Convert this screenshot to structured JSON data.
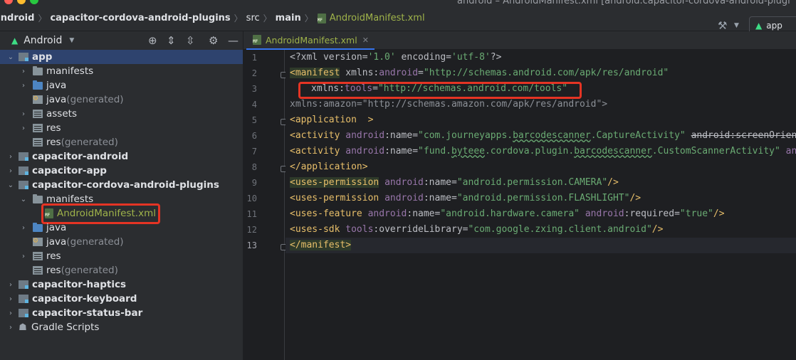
{
  "window": {
    "title": "android – AndroidManifest.xml [android.capacitor-cordova-android-plugi"
  },
  "breadcrumb": [
    "android",
    "capacitor-cordova-android-plugins",
    "src",
    "main",
    "AndroidManifest.xml"
  ],
  "toolbar": {
    "run_config": "app"
  },
  "project_panel": {
    "view_mode": "Android",
    "tree": [
      {
        "label": "app",
        "suffix": ""
      },
      {
        "label": "manifests",
        "suffix": ""
      },
      {
        "label": "java",
        "suffix": ""
      },
      {
        "label": "java",
        "suffix": " (generated)"
      },
      {
        "label": "assets",
        "suffix": ""
      },
      {
        "label": "res",
        "suffix": ""
      },
      {
        "label": "res",
        "suffix": " (generated)"
      },
      {
        "label": "capacitor-android",
        "suffix": ""
      },
      {
        "label": "capacitor-app",
        "suffix": ""
      },
      {
        "label": "capacitor-cordova-android-plugins",
        "suffix": ""
      },
      {
        "label": "manifests",
        "suffix": ""
      },
      {
        "label": "AndroidManifest.xml",
        "suffix": ""
      },
      {
        "label": "java",
        "suffix": ""
      },
      {
        "label": "java",
        "suffix": " (generated)"
      },
      {
        "label": "res",
        "suffix": ""
      },
      {
        "label": "res",
        "suffix": " (generated)"
      },
      {
        "label": "capacitor-haptics",
        "suffix": ""
      },
      {
        "label": "capacitor-keyboard",
        "suffix": ""
      },
      {
        "label": "capacitor-status-bar",
        "suffix": ""
      },
      {
        "label": "Gradle Scripts",
        "suffix": ""
      }
    ]
  },
  "editor": {
    "tab_label": "AndroidManifest.xml",
    "line_numbers": [
      "1",
      "2",
      "3",
      "4",
      "5",
      "6",
      "7",
      "8",
      "9",
      "10",
      "11",
      "12",
      "13"
    ],
    "lines": {
      "l1": {
        "a": "<?xml version=",
        "b": "'1.0'",
        "c": " encoding=",
        "d": "'utf-8'",
        "e": "?>"
      },
      "l2": {
        "tag": "<manifest",
        "a1": " xmlns:",
        "a1ns": "android",
        "a1eq": "=",
        "v1": "\"http://schemas.android.com/apk/res/android\""
      },
      "l3": {
        "a": "xmlns:",
        "ns": "tools",
        "eq": "=",
        "v": "\"http://schemas.android.com/tools\""
      },
      "l4": {
        "text": "xmlns:amazon=\"http://schemas.amazon.com/apk/res/android\">"
      },
      "l5": {
        "tag": "<application",
        "rest": "  >"
      },
      "l6": {
        "tag": "<activity",
        "ns": "android",
        "attr": ":name=",
        "v1": "\"com.journeyapps.",
        "v2": "barcodescanner",
        "v3": ".CaptureActivity\"",
        "strike_ns": "android",
        "strike_attr": ":screenOrient"
      },
      "l7": {
        "tag": "<activity",
        "ns": "android",
        "attr": ":name=",
        "v1": "\"fund.",
        "v2": "byteee",
        "v3": ".cordova.plugin.",
        "v4": "barcodescanner",
        "v5": ".CustomScannerActivity\"",
        "tail": " and"
      },
      "l8": {
        "tag": "</application>"
      },
      "l9": {
        "tag": "<uses-permission",
        "ns": "android",
        "attr": ":name=",
        "v": "\"android.permission.CAMERA\"",
        "end": "/>"
      },
      "l10": {
        "tag": "<uses-permission",
        "ns": "android",
        "attr": ":name=",
        "v": "\"android.permission.FLASHLIGHT\"",
        "end": "/>"
      },
      "l11": {
        "tag": "<uses-feature",
        "ns": "android",
        "attr": ":name=",
        "v": "\"android.hardware.camera\"",
        "ns2": "android",
        "attr2": ":required=",
        "v2": "\"true\"",
        "end": "/>"
      },
      "l12": {
        "tag": "<uses-sdk",
        "ns": "tools",
        "attr": ":overrideLibrary=",
        "v": "\"com.google.zxing.client.android\"",
        "end": "/>"
      },
      "l13": {
        "tag": "</manifest>"
      }
    }
  },
  "colors": {
    "highlight_box": "#e53424",
    "selection": "#2e436e",
    "manifest_file": "#9fb34a"
  }
}
